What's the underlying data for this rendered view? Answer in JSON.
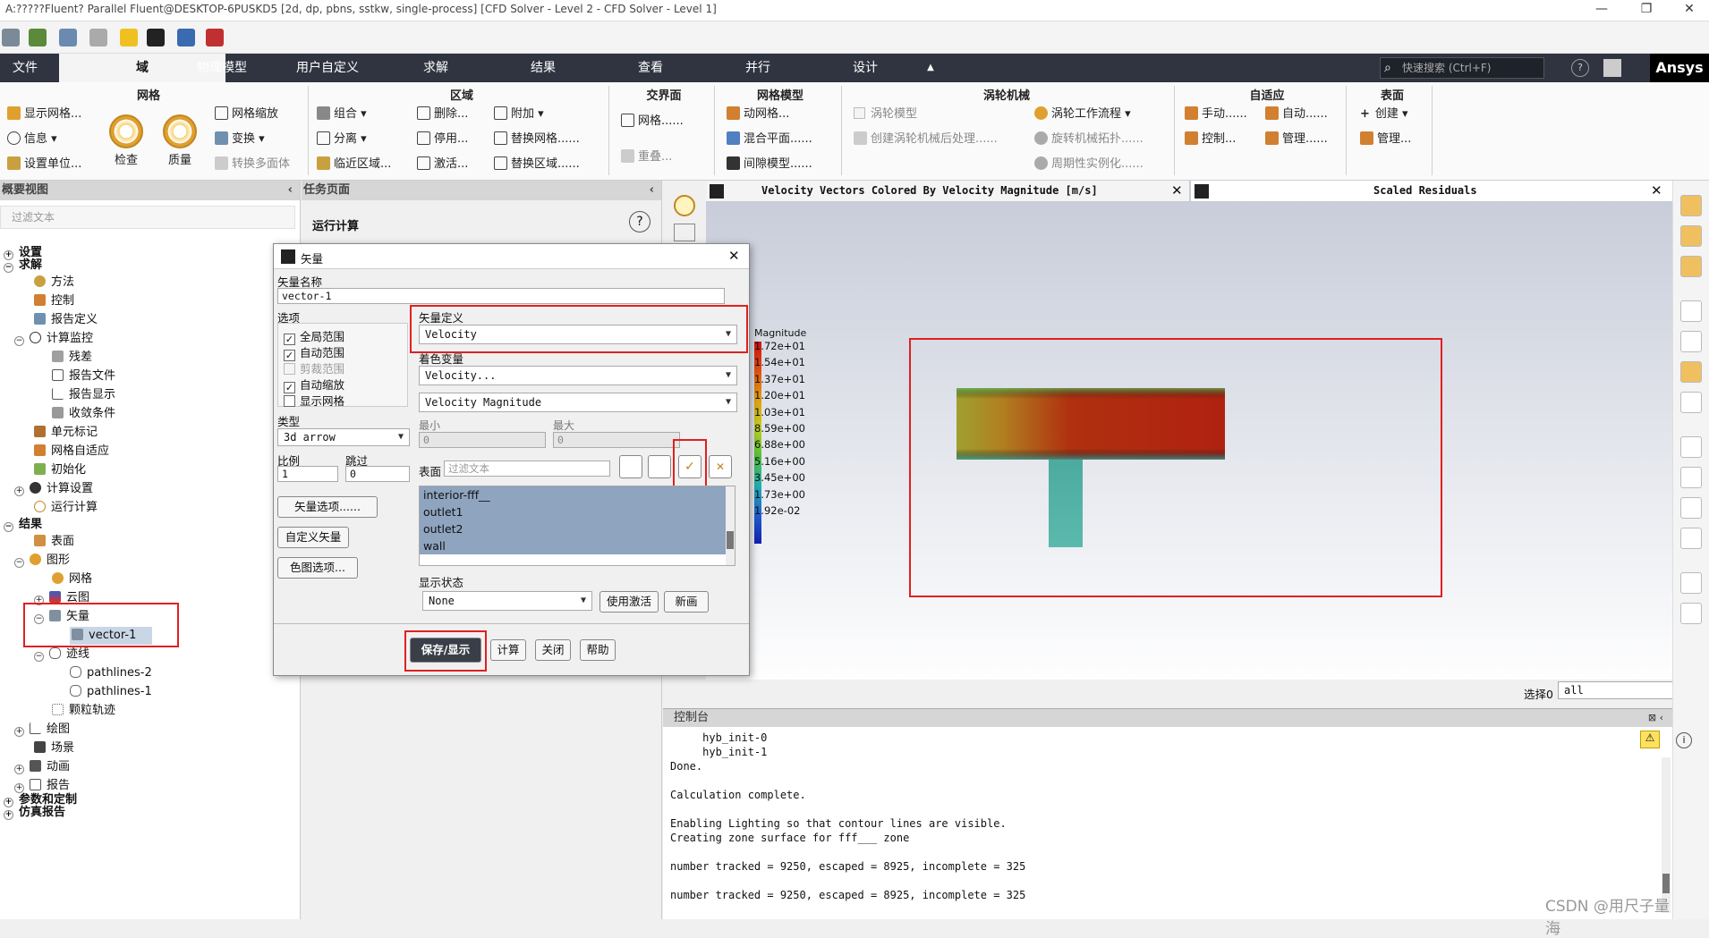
{
  "window": {
    "title": "A:?????Fluent? Parallel Fluent@DESKTOP-6PUSKD5  [2d, dp, pbns, sstkw, single-process] [CFD Solver - Level 2 - CFD Solver - Level 1]"
  },
  "menu": {
    "tabs": [
      "文件",
      "域",
      "物理模型",
      "用户自定义",
      "求解",
      "结果",
      "查看",
      "并行",
      "设计"
    ],
    "search_placeholder": "快速搜索 (Ctrl+F)",
    "brand": "Ansys"
  },
  "ribbon": {
    "groups": [
      "网格",
      "区域",
      "交界面",
      "网格模型",
      "涡轮机械",
      "自适应",
      "表面"
    ],
    "mesh": {
      "display": "显示网格...",
      "info": "信息",
      "units": "设置单位...",
      "check": "检查",
      "quality": "质量",
      "scale": "网格缩放",
      "transform": "变换",
      "convert": "转换多面体"
    },
    "zone": {
      "combine": "组合",
      "separate": "分离",
      "adjacency": "临近区域...",
      "delete": "删除...",
      "deactivate": "停用...",
      "activate": "激活...",
      "append": "附加",
      "replace_mesh": "替换网格......",
      "replace_zone": "替换区域......"
    },
    "interface": {
      "mesh": "网格......",
      "overlap": "重叠..."
    },
    "mesh_models": {
      "dynamic": "动网格...",
      "mixing": "混合平面......",
      "gap": "间隙模型......"
    },
    "turbo": {
      "model": "涡轮模型",
      "post": "创建涡轮机械后处理......",
      "workflow": "涡轮工作流程",
      "topology": "旋转机械拓扑......",
      "periodic": "周期性实例化......"
    },
    "adapt": {
      "manual": "手动......",
      "auto": "自动......",
      "control": "控制...",
      "manage": "管理......"
    },
    "surface": {
      "create": "创建",
      "manage": "管理..."
    }
  },
  "outline": {
    "header": "概要视图",
    "filter_placeholder": "过滤文本",
    "items": [
      "设置",
      "求解",
      "方法",
      "控制",
      "报告定义",
      "计算监控",
      "残差",
      "报告文件",
      "报告显示",
      "收敛条件",
      "单元标记",
      "网格自适应",
      "初始化",
      "计算设置",
      "运行计算",
      "结果",
      "表面",
      "图形",
      "网格",
      "云图",
      "矢量",
      "vector-1",
      "迹线",
      "pathlines-2",
      "pathlines-1",
      "颗粒轨迹",
      "绘图",
      "场景",
      "动画",
      "报告",
      "参数和定制",
      "仿真报告"
    ]
  },
  "task": {
    "header": "任务页面",
    "title": "运行计算"
  },
  "dialog": {
    "title": "矢量",
    "name_label": "矢量名称",
    "name_value": "vector-1",
    "options_label": "选项",
    "options": [
      {
        "label": "全局范围",
        "checked": "✓"
      },
      {
        "label": "自动范围",
        "checked": "✓"
      },
      {
        "label": "剪裁范围",
        "checked": ""
      },
      {
        "label": "自动缩放",
        "checked": "✓"
      },
      {
        "label": "显示网格",
        "checked": ""
      }
    ],
    "vector_def_label": "矢量定义",
    "vector_def_value": "Velocity",
    "color_label": "着色变量",
    "color_value1": "Velocity...",
    "color_value2": "Velocity Magnitude",
    "min_label": "最小",
    "max_label": "最大",
    "min_value": "0",
    "max_value": "0",
    "type_label": "类型",
    "type_value": "3d arrow",
    "scale_label": "比例",
    "skip_label": "跳过",
    "scale_value": "1",
    "skip_value": "0",
    "vec_options_btn": "矢量选项......",
    "custom_vec_btn": "自定义矢量",
    "colormap_btn": "色图选项...",
    "surface_label": "表面",
    "surface_filter": "过滤文本",
    "surfaces": [
      "interior-fff__",
      "outlet1",
      "outlet2",
      "wall"
    ],
    "display_state_label": "显示状态",
    "display_state_value": "None",
    "use_active_btn": "使用激活",
    "new_btn": "新画",
    "save_display_btn": "保存/显示",
    "compute_btn": "计算",
    "close_btn": "关闭",
    "help_btn": "帮助"
  },
  "graphics": {
    "tab1_title": "Velocity Vectors Colored By Velocity Magnitude [m/s]",
    "tab2_title": "Scaled Residuals",
    "legend_title": "Magnitude",
    "legend_values": [
      "1.72e+01",
      "1.54e+01",
      "1.37e+01",
      "1.20e+01",
      "1.03e+01",
      "8.59e+00",
      "6.88e+00",
      "5.16e+00",
      "3.45e+00",
      "1.73e+00",
      "1.92e-02"
    ],
    "select_label": "选择0",
    "select_value": "all"
  },
  "console": {
    "header": "控制台",
    "lines": [
      "     hyb_init-0",
      "     hyb_init-1",
      "Done.",
      "",
      "Calculation complete.",
      "",
      "Enabling Lighting so that contour lines are visible.",
      "Creating zone surface for fff___ zone",
      "",
      "number tracked = 9250, escaped = 8925, incomplete = 325",
      "",
      "number tracked = 9250, escaped = 8925, incomplete = 325"
    ]
  },
  "watermark": "CSDN @用尺子量海",
  "colors": {
    "accent_red": "#e02020",
    "menubar": "#2f3440",
    "selection": "#8ea4bf"
  }
}
